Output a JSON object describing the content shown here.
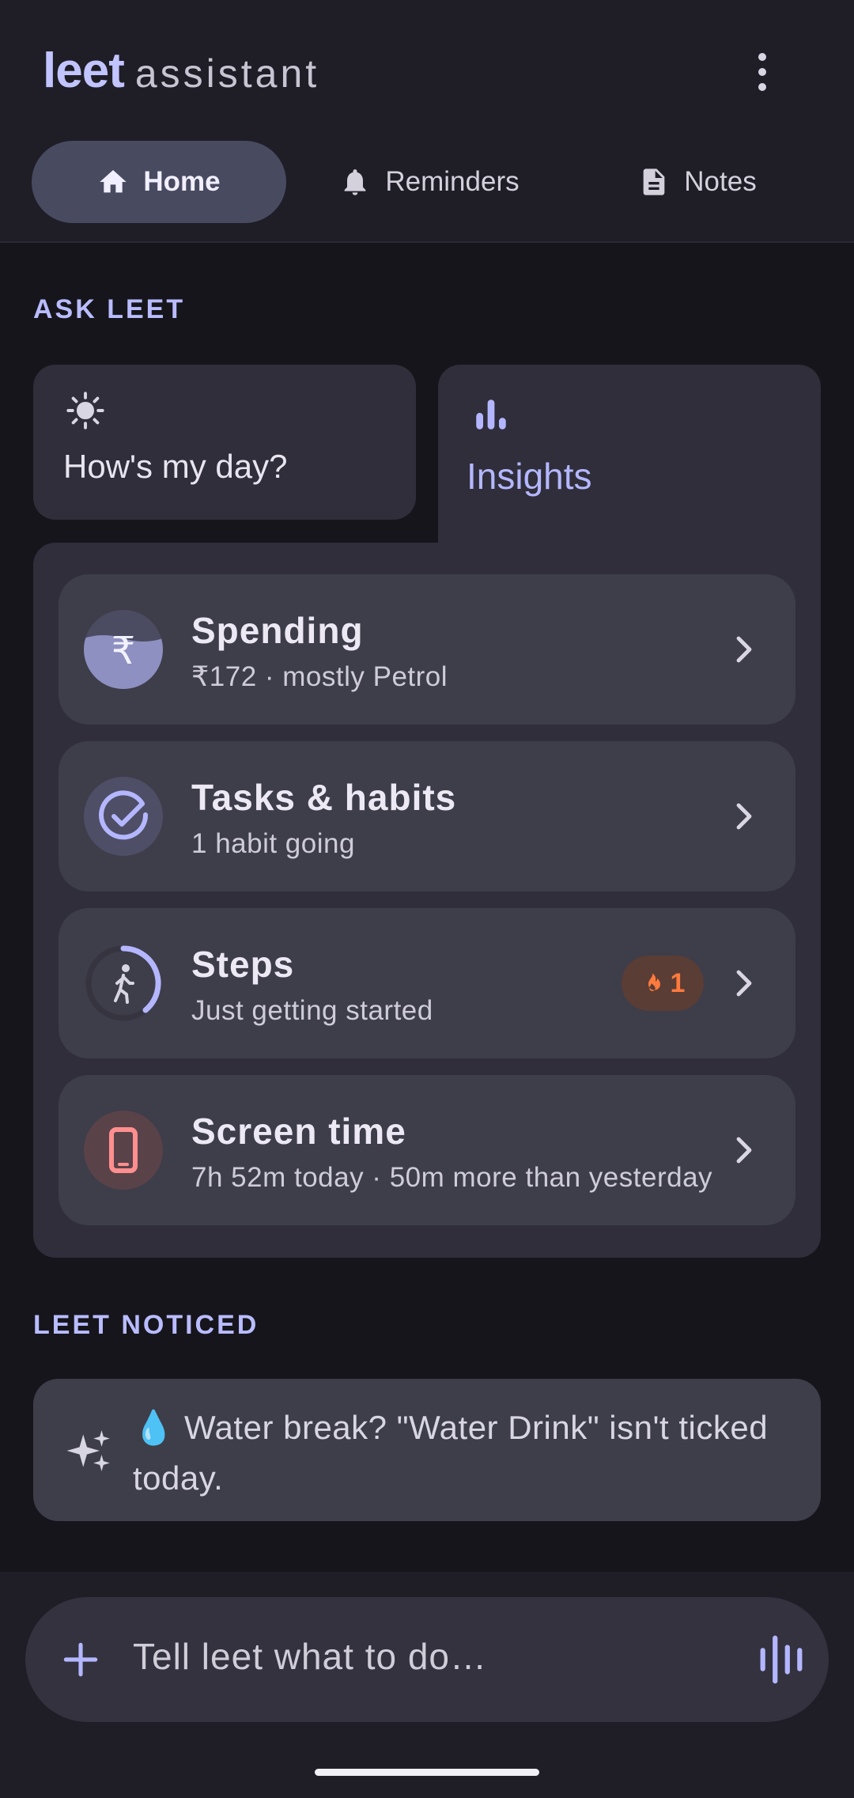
{
  "app": {
    "brand_bold": "leet",
    "brand_light": "assistant"
  },
  "tabs": [
    {
      "label": "Home",
      "icon": "home-icon",
      "active": true
    },
    {
      "label": "Reminders",
      "icon": "bell-icon",
      "active": false
    },
    {
      "label": "Notes",
      "icon": "document-icon",
      "active": false
    }
  ],
  "ask": {
    "section_title": "ASK LEET",
    "chips": [
      {
        "label": "How's my day?",
        "icon": "sun-icon"
      },
      {
        "label": "Insights",
        "icon": "bar-chart-icon",
        "selected": true
      }
    ]
  },
  "insights": [
    {
      "title": "Spending",
      "subtitle": "₹172 · mostly Petrol",
      "icon": "rupee-icon",
      "fill_fraction": 0.4
    },
    {
      "title": "Tasks & habits",
      "subtitle": "1 habit going",
      "icon": "check-circle-icon"
    },
    {
      "title": "Steps",
      "subtitle": "Just getting started",
      "icon": "walking-icon",
      "badge": {
        "icon": "flame-icon",
        "value": "1"
      },
      "ring_progress": 0.3
    },
    {
      "title": "Screen time",
      "subtitle": "7h 52m today · 50m more than yesterday",
      "icon": "phone-icon"
    }
  ],
  "noticed": {
    "section_title": "LEET NOTICED",
    "icon": "sparkle-icon",
    "emoji": "💧",
    "text": "Water break? \"Water Drink\" isn't ticked today."
  },
  "composer": {
    "placeholder": "Tell leet what to do…",
    "add_icon": "plus-icon",
    "voice_icon": "voice-waveform-icon"
  },
  "colors": {
    "accent": "#b9bcff",
    "background": "#16151b",
    "card": "#3e3d4a",
    "flame": "#ff7a3d",
    "screen_time": "#ff8f8f"
  }
}
